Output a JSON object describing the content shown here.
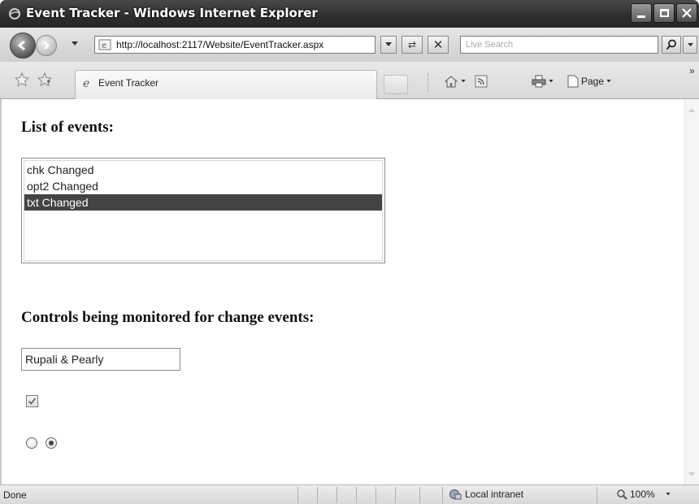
{
  "window": {
    "title": "Event Tracker - Windows Internet Explorer"
  },
  "address_bar": {
    "url": "http://localhost:2117/Website/EventTracker.aspx",
    "search_placeholder": "Live Search"
  },
  "tabs": [
    {
      "label": "Event Tracker",
      "icon": "ie-page-icon"
    }
  ],
  "command_bar": {
    "page_label": "Page"
  },
  "page": {
    "heading_events": "List of events:",
    "events": [
      "chk Changed",
      "opt2 Changed",
      "txt Changed"
    ],
    "selected_event_index": 2,
    "heading_controls": "Controls being monitored for change events:",
    "textbox_value": "Rupali & Pearly",
    "checkbox_checked": true,
    "radio_options": [
      {
        "id": "opt1",
        "checked": false
      },
      {
        "id": "opt2",
        "checked": true
      }
    ]
  },
  "status_bar": {
    "status": "Done",
    "zone": "Local intranet",
    "zoom": "100%"
  },
  "colors": {
    "titlebar": "#2e2e2e",
    "selected_item": "#444444",
    "chrome": "#d9d9d9"
  }
}
